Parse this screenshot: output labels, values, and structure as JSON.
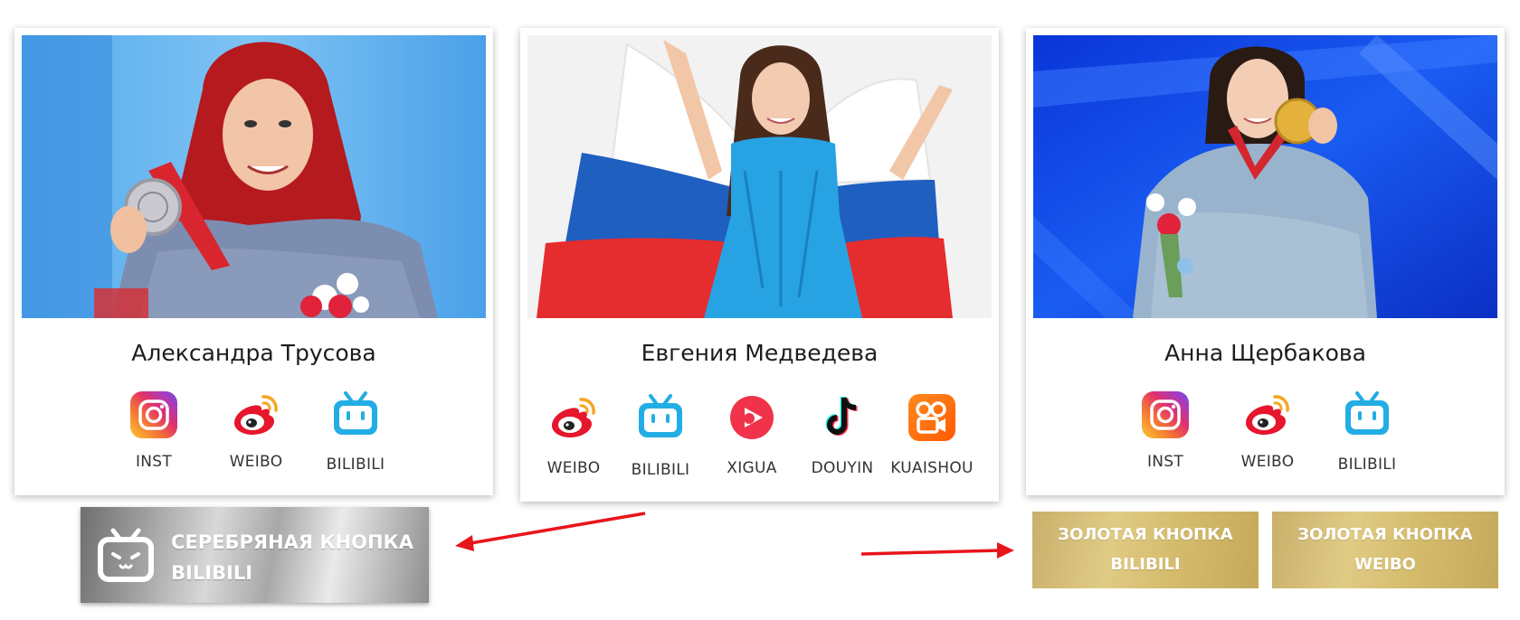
{
  "cards": [
    {
      "name": "Александра Трусова",
      "photo": "athlete-photo-silver-medal",
      "socials": [
        {
          "label": "INST",
          "icon": "instagram-icon"
        },
        {
          "label": "WEIBO",
          "icon": "weibo-icon"
        },
        {
          "label": "BILIBILI",
          "icon": "bilibili-icon"
        }
      ]
    },
    {
      "name": "Евгения Медведева",
      "photo": "athlete-photo-russian-flag",
      "socials": [
        {
          "label": "WEIBO",
          "icon": "weibo-icon"
        },
        {
          "label": "BILIBILI",
          "icon": "bilibili-icon"
        },
        {
          "label": "XIGUA",
          "icon": "xigua-icon"
        },
        {
          "label": "DOUYIN",
          "icon": "douyin-icon"
        },
        {
          "label": "KUAISHOU",
          "icon": "kuaishou-icon"
        }
      ]
    },
    {
      "name": "Анна Щербакова",
      "photo": "athlete-photo-gold-medal",
      "socials": [
        {
          "label": "INST",
          "icon": "instagram-icon"
        },
        {
          "label": "WEIBO",
          "icon": "weibo-icon"
        },
        {
          "label": "BILIBILI",
          "icon": "bilibili-icon"
        }
      ]
    }
  ],
  "buttons": {
    "silver": {
      "line1": "СЕРЕБРЯНАЯ КНОПКА",
      "line2": "BILIBILI",
      "icon": "bilibili-tv-icon"
    },
    "gold_bilibili": {
      "line1": "ЗОЛОТАЯ КНОПКА",
      "line2": "BILIBILI"
    },
    "gold_weibo": {
      "line1": "ЗОЛОТАЯ КНОПКА",
      "line2": "WEIBO"
    }
  },
  "colors": {
    "arrow": "#e8151b",
    "instagram": "#c13584",
    "weibo": "#e6162d",
    "bilibili": "#23ade5",
    "xigua": "#f0334a",
    "kuaishou": "#ff6a00",
    "gold": "#d6bd6e"
  }
}
